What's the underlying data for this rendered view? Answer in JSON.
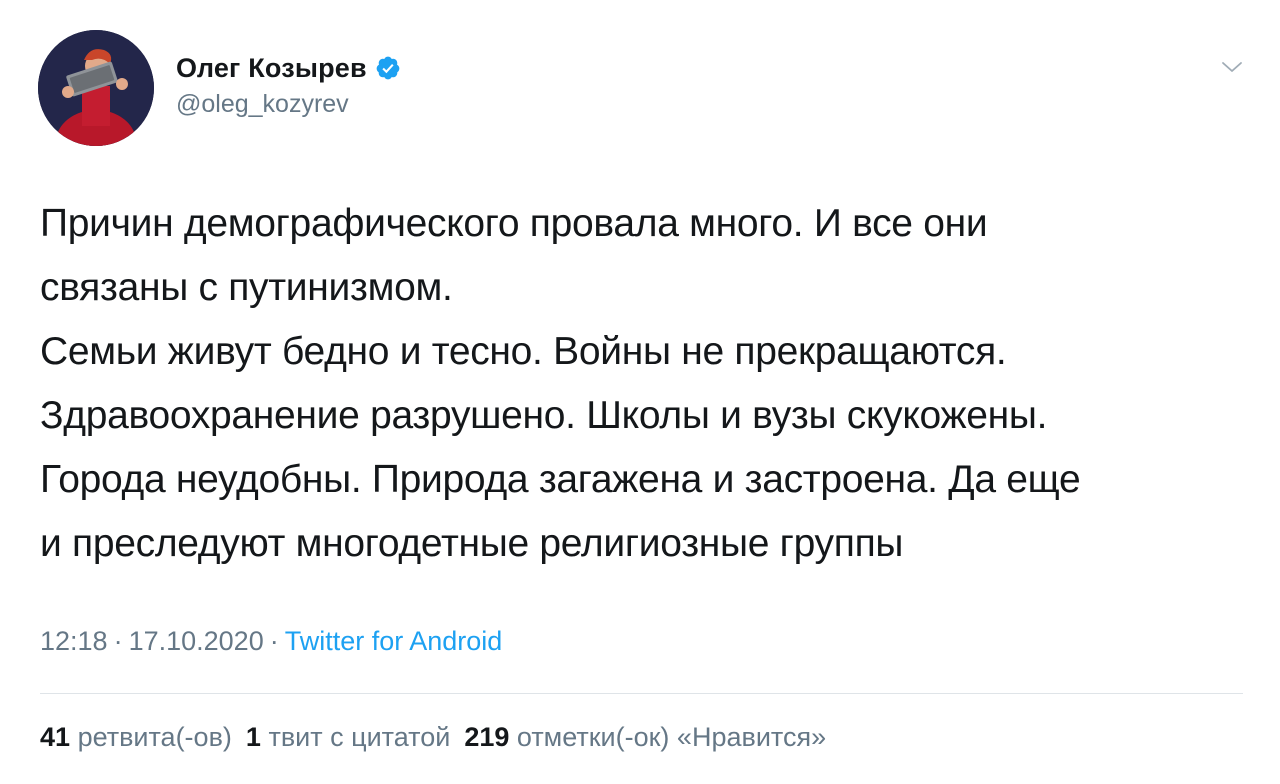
{
  "author": {
    "name": "Олег Козырев",
    "handle": "@oleg_kozyrev",
    "verified": true,
    "avatar_icon": "user-photo"
  },
  "tweet": {
    "lines": [
      "Причин демографического провала много. И все они",
      "связаны с путинизмом.",
      "Семьи живут бедно и тесно. Войны не прекращаются.",
      "Здравоохранение разрушено. Школы и вузы скукожены.",
      "Города неудобны. Природа загажена и застроена. Да еще",
      "и преследуют многодетные религиозные группы"
    ]
  },
  "meta": {
    "time": "12:18",
    "separator": "·",
    "date": "17.10.2020",
    "source": "Twitter for Android"
  },
  "stats": {
    "retweets_count": "41",
    "retweets_label": "ретвита(-ов)",
    "quotes_count": "1",
    "quotes_label": "твит с цитатой",
    "likes_count": "219",
    "likes_label": "отметки(-ок) «Нравится»"
  },
  "colors": {
    "accent": "#1da1f2",
    "secondary_text": "#657786",
    "primary_text": "#14171a",
    "divider": "#dfe4e8"
  }
}
